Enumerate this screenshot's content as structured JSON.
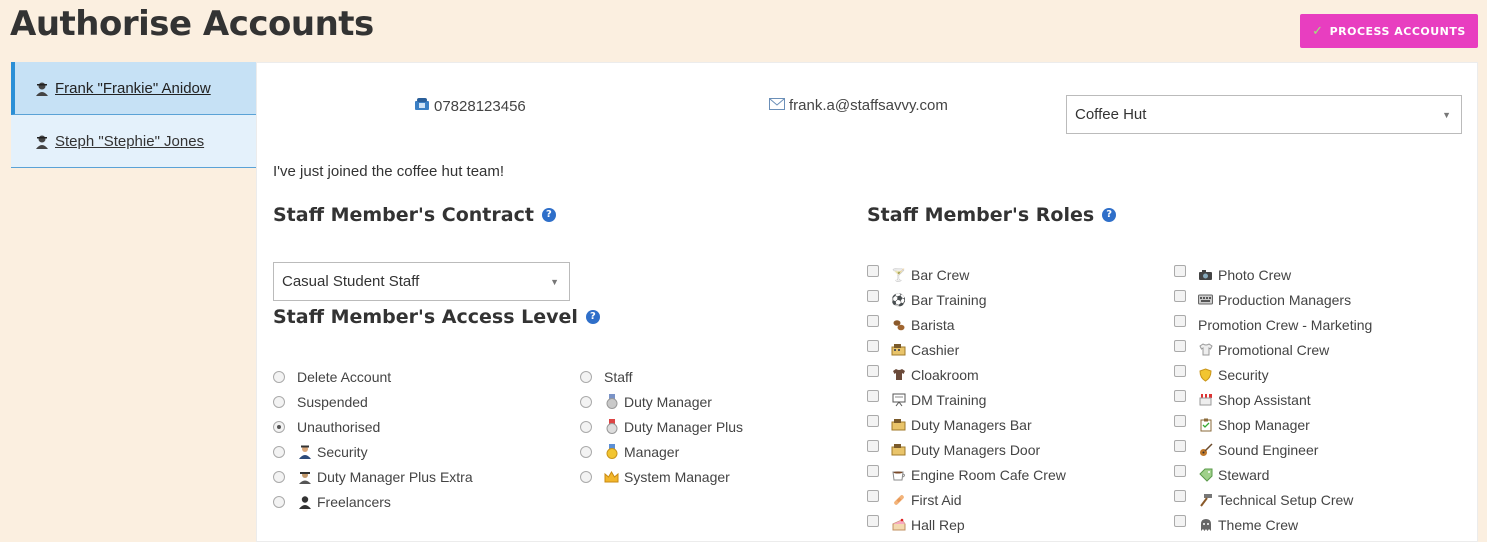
{
  "page": {
    "title": "Authorise Accounts"
  },
  "toolbar": {
    "process_label": "PROCESS ACCOUNTS"
  },
  "sidebar": {
    "items": [
      {
        "label": "Frank \"Frankie\" Anidow",
        "active": true
      },
      {
        "label": "Steph \"Stephie\" Jones",
        "active": false
      }
    ]
  },
  "member": {
    "phone": "07828123456",
    "email": "frank.a@staffsavvy.com",
    "venue_selected": "Coffee Hut",
    "bio": "I've just joined the coffee hut team!"
  },
  "contract": {
    "heading": "Staff Member's Contract",
    "selected": "Casual Student Staff"
  },
  "access": {
    "heading": "Staff Member's Access Level",
    "col1": [
      {
        "label": "Delete Account",
        "icon": "",
        "checked": false
      },
      {
        "label": "Suspended",
        "icon": "",
        "checked": false
      },
      {
        "label": "Unauthorised",
        "icon": "",
        "checked": true
      },
      {
        "label": "Security",
        "icon": "security-person-icon",
        "checked": false
      },
      {
        "label": "Duty Manager Plus Extra",
        "icon": "spy-icon",
        "checked": false
      },
      {
        "label": "Freelancers",
        "icon": "person-silhouette-icon",
        "checked": false
      }
    ],
    "col2": [
      {
        "label": "Staff",
        "icon": "",
        "checked": false
      },
      {
        "label": "Duty Manager",
        "icon": "silver-medal-icon",
        "checked": false
      },
      {
        "label": "Duty Manager Plus",
        "icon": "red-medal-icon",
        "checked": false
      },
      {
        "label": "Manager",
        "icon": "gold-medal-icon",
        "checked": false
      },
      {
        "label": "System Manager",
        "icon": "crown-icon",
        "checked": false
      }
    ]
  },
  "roles": {
    "heading": "Staff Member's Roles",
    "col1": [
      {
        "label": "Bar Crew",
        "icon": "cocktail-glass-icon"
      },
      {
        "label": "Bar Training",
        "icon": "football-icon"
      },
      {
        "label": "Barista",
        "icon": "coffee-beans-icon"
      },
      {
        "label": "Cashier",
        "icon": "cash-register-icon"
      },
      {
        "label": "Cloakroom",
        "icon": "tshirt-icon"
      },
      {
        "label": "DM Training",
        "icon": "presentation-board-icon"
      },
      {
        "label": "Duty Managers Bar",
        "icon": "cash-register-icon"
      },
      {
        "label": "Duty Managers Door",
        "icon": "cash-register-icon"
      },
      {
        "label": "Engine Room Cafe Crew",
        "icon": "coffee-cup-icon"
      },
      {
        "label": "First Aid",
        "icon": "bandage-icon"
      },
      {
        "label": "Hall Rep",
        "icon": "cake-icon"
      }
    ],
    "col2": [
      {
        "label": "Photo Crew",
        "icon": "camera-icon"
      },
      {
        "label": "Production Managers",
        "icon": "keyboard-icon"
      },
      {
        "label": "Promotion Crew - Marketing",
        "icon": ""
      },
      {
        "label": "Promotional Crew",
        "icon": "tshirt-white-icon"
      },
      {
        "label": "Security",
        "icon": "shield-icon"
      },
      {
        "label": "Shop Assistant",
        "icon": "shop-icon"
      },
      {
        "label": "Shop Manager",
        "icon": "clipboard-icon"
      },
      {
        "label": "Sound Engineer",
        "icon": "guitar-icon"
      },
      {
        "label": "Steward",
        "icon": "tag-icon"
      },
      {
        "label": "Technical Setup Crew",
        "icon": "hammer-icon"
      },
      {
        "label": "Theme Crew",
        "icon": "ghost-icon"
      }
    ]
  }
}
